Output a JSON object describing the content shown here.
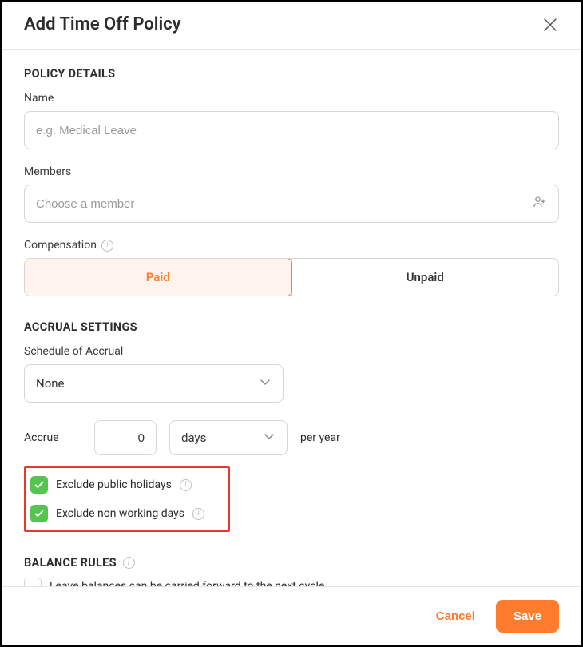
{
  "modal": {
    "title": "Add Time Off Policy",
    "sections": {
      "policy_details": {
        "heading": "POLICY DETAILS",
        "name": {
          "label": "Name",
          "value": "",
          "placeholder": "e.g. Medical Leave"
        },
        "members": {
          "label": "Members",
          "value": "",
          "placeholder": "Choose a member"
        },
        "compensation": {
          "label": "Compensation",
          "options": {
            "paid": "Paid",
            "unpaid": "Unpaid"
          },
          "selected": "paid"
        }
      },
      "accrual_settings": {
        "heading": "ACCRUAL SETTINGS",
        "schedule": {
          "label": "Schedule of Accrual",
          "selected": "None"
        },
        "accrue": {
          "label": "Accrue",
          "amount": "0",
          "unit_selected": "days",
          "suffix": "per year"
        },
        "excludes": {
          "public_holidays": {
            "label": "Exclude public holidays",
            "checked": true
          },
          "non_working_days": {
            "label": "Exclude non working days",
            "checked": true
          }
        }
      },
      "balance_rules": {
        "heading": "BALANCE RULES",
        "carry_forward": {
          "label": "Leave balances can be carried forward to the next cycle",
          "checked": false
        }
      }
    },
    "footer": {
      "cancel": "Cancel",
      "save": "Save"
    }
  }
}
